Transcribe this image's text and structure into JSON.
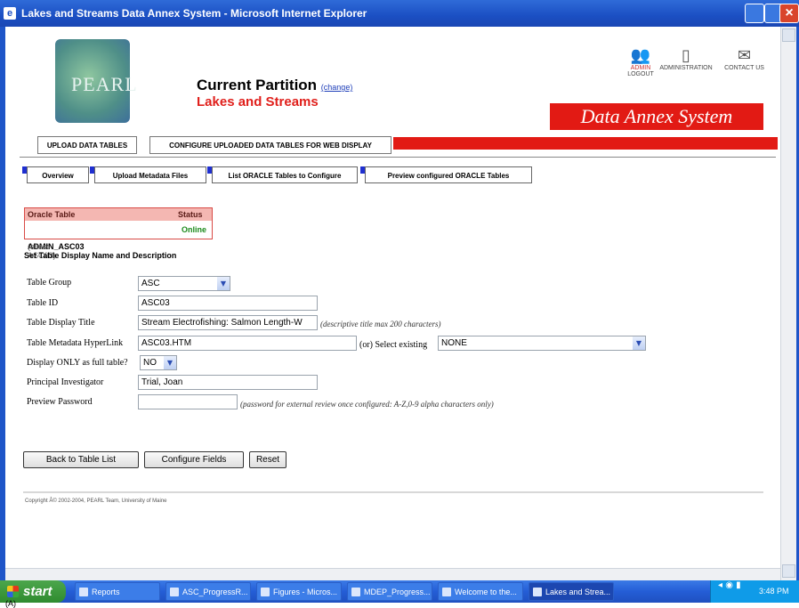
{
  "window": {
    "title": "Lakes and Streams Data Annex System - Microsoft Internet Explorer"
  },
  "header": {
    "logo_text": "PEARL",
    "partition_label": "Current Partition",
    "change_link": "(change)",
    "partition_value": "Lakes and Streams",
    "icons": {
      "admin_label1": "ADMIN",
      "admin_label2": "LOGOUT",
      "administration_label": "ADMINISTRATION",
      "contact_label": "CONTACT US"
    },
    "system_title": "Data Annex System"
  },
  "main_nav": {
    "tabs": [
      "UPLOAD DATA TABLES",
      "CONFIGURE UPLOADED DATA TABLES FOR WEB DISPLAY"
    ]
  },
  "sub_nav": {
    "tabs": [
      "Overview",
      "Upload Metadata Files",
      "List ORACLE Tables to Configure",
      "Preview configured ORACLE Tables"
    ]
  },
  "status_table": {
    "headers": [
      "Oracle Table",
      "Status"
    ],
    "row": {
      "table": "ADMIN_ASC03",
      "alias": "(alias: ASC03)",
      "status": "Online"
    }
  },
  "form": {
    "section_title": "Set Table Display Name and Description",
    "table_group": {
      "label": "Table Group",
      "value": "ASC"
    },
    "table_id": {
      "label": "Table ID",
      "value": "ASC03"
    },
    "display_title": {
      "label": "Table Display Title",
      "value": "Stream Electrofishing: Salmon Length-W",
      "hint": "(descriptive title max 200 characters)"
    },
    "metadata_link": {
      "label": "Table Metadata HyperLink",
      "value": "ASC03.HTM",
      "or_label": "(or) Select existing",
      "select_value": "NONE"
    },
    "full_table": {
      "label": "Display ONLY as full table?",
      "value": "NO"
    },
    "investigator": {
      "label": "Principal Investigator",
      "value": "Trial, Joan"
    },
    "password": {
      "label": "Preview Password",
      "value": "",
      "hint": "(password for external review once configured: A-Z,0-9 alpha characters only)"
    }
  },
  "buttons": {
    "back": "Back to Table List",
    "configure": "Configure Fields",
    "reset": "Reset"
  },
  "footer": {
    "copyright": "Copyright Â© 2002-2004, PEARL Team, University of Maine"
  },
  "taskbar": {
    "start": "start",
    "items": [
      "Reports",
      "ASC_ProgressR...",
      "Figures - Micros...",
      "MDEP_Progress...",
      "Welcome to the...",
      "Lakes and Strea..."
    ],
    "time": "3:48 PM"
  },
  "below_caption": "(A)"
}
